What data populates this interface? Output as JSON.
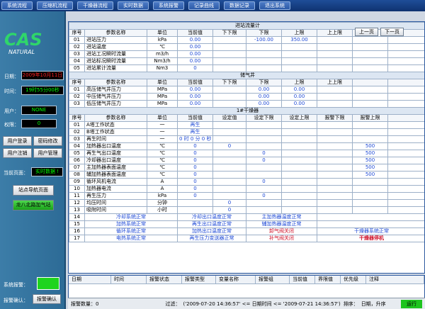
{
  "menu": [
    "系统流程",
    "压缩机流程",
    "干燥器流程",
    "实时数据",
    "系统报警",
    "记录曲线",
    "数据记录",
    "退出系统"
  ],
  "logo": {
    "letters": "CAS",
    "sub": "NATURAL"
  },
  "left": {
    "date_label": "日期：",
    "date_value": "2009年10月11日",
    "time_label": "时间：",
    "time_value": "19时55分00秒",
    "user_label": "用户：",
    "user_value": "NONE",
    "perm_label": "权限：",
    "perm_value": "0",
    "btn_login": "用户登录",
    "btn_pwd": "密码修改",
    "btn_logout": "用户注销",
    "btn_manage": "用户管理",
    "page_label": "当前页面：",
    "page_value": "实时数据 !",
    "btn_nav": "站点导航页面",
    "btn_station": "龙八北路加气站",
    "sys_alarm_label": "系统报警：",
    "alarm_confirm_label": "报警确认：",
    "alarm_confirm_btn": "报警确认"
  },
  "pager": {
    "prev": "上一页",
    "next": "下一页"
  },
  "sec1": {
    "title": "进站流量计",
    "headers": [
      "序号",
      "参数名称",
      "单位",
      "当前值",
      "下下限",
      "下限",
      "上限",
      "上上限"
    ],
    "rows": [
      [
        "01",
        "进站压力",
        "kPa",
        "0.00",
        "",
        "-100.00",
        "350.00",
        ""
      ],
      [
        "02",
        "进站温度",
        "℃",
        "0.00",
        "",
        "",
        "",
        ""
      ],
      [
        "03",
        "进站工况瞬时流量",
        "m3/h",
        "0.00",
        "",
        "",
        "",
        ""
      ],
      [
        "04",
        "进站标况瞬时流量",
        "Nm3/h",
        "0.00",
        "",
        "",
        "",
        ""
      ],
      [
        "05",
        "进站累计流量",
        "Nm3",
        "0",
        "",
        "",
        "",
        ""
      ]
    ]
  },
  "sec2": {
    "title": "储气井",
    "headers": [
      "序号",
      "参数名称",
      "单位",
      "当前值",
      "下下限",
      "下限",
      "上限",
      "上上限"
    ],
    "rows": [
      [
        "01",
        "高压储气井压力",
        "MPa",
        "0.00",
        "",
        "0.00",
        "0.00",
        ""
      ],
      [
        "02",
        "中压储气井压力",
        "MPa",
        "0.00",
        "",
        "0.00",
        "0.00",
        ""
      ],
      [
        "03",
        "低压储气井压力",
        "MPa",
        "0.00",
        "",
        "0.00",
        "0.00",
        ""
      ]
    ]
  },
  "sec3": {
    "title": "1#干燥器",
    "headers": [
      "序号",
      "参数名称",
      "单位",
      "当前值",
      "设定值",
      "设定下限",
      "设定上限",
      "报警下限",
      "报警上限"
    ],
    "rows": [
      [
        "01",
        "A塔工作状态",
        "一",
        "再生",
        "",
        "",
        "",
        "",
        ""
      ],
      [
        "02",
        "B塔工作状态",
        "一",
        "再生",
        "",
        "",
        "",
        "",
        ""
      ],
      [
        "03",
        "再生时间",
        "一",
        "0 时 0 分 0 秒",
        "",
        "",
        "",
        "",
        ""
      ],
      [
        "04",
        "加热器出口温度",
        "℃",
        "0",
        "0",
        "",
        "",
        "",
        "500"
      ],
      [
        "05",
        "再生气出口温度",
        "℃",
        "0",
        "",
        "0",
        "",
        "",
        "500"
      ],
      [
        "06",
        "冷却器出口温度",
        "℃",
        "0",
        "",
        "0",
        "",
        "",
        "500"
      ],
      [
        "07",
        "主加热器表面温度",
        "℃",
        "0",
        "",
        "",
        "",
        "",
        "500"
      ],
      [
        "08",
        "辅加热器表面温度",
        "℃",
        "0",
        "",
        "",
        "",
        "",
        "500"
      ],
      [
        "09",
        "循环风机电流",
        "A",
        "0",
        "",
        "0",
        "",
        "",
        ""
      ],
      [
        "10",
        "加热器电流",
        "A",
        "0",
        "",
        "",
        "",
        "",
        ""
      ],
      [
        "11",
        "再生压力",
        "kPa",
        "0",
        "",
        "0",
        "",
        "",
        ""
      ],
      [
        "12",
        "均压时间",
        "分钟",
        "",
        "0",
        "",
        "",
        "",
        ""
      ],
      [
        "13",
        "吸附时间",
        "小时",
        "",
        "0",
        "",
        "",
        "",
        ""
      ]
    ],
    "status": [
      [
        "14",
        "冷却系统正常",
        "冷却出口温度正常",
        "主加热器温度正常",
        ""
      ],
      [
        "15",
        "加热系统正常",
        "再生出口温度正常",
        "辅加热器温度正常",
        ""
      ],
      [
        "16",
        "循环系统正常",
        "加热出口温度正常",
        "卸气阀关闭",
        "干燥器系统正常"
      ],
      [
        "17",
        "电热系统正常",
        "再生压力变送器正常",
        "补气阀关闭",
        "干燥器停机"
      ]
    ]
  },
  "alarm": {
    "cols": [
      "日期",
      "时间",
      "报警状态",
      "报警类型",
      "变量名称",
      "报警组",
      "当前值",
      "界限值",
      "优先级",
      "注释"
    ]
  },
  "statusbar": {
    "count": "报警数量：0",
    "filter_label": "过滤：",
    "filter": "('2009-07-20 14:36:57' <= 日期时间 <= '2009-07-21 14:36:57')",
    "sort_label": "排序：",
    "sort": "日期，升序",
    "state": "运行"
  },
  "colors": {
    "menu_bg": "#0f3270",
    "left_bg": "#3c7da8",
    "value_blue": "#1d49d6",
    "alarm_red": "#d0152c",
    "led_green": "#00ff00",
    "led_red": "#ff2020"
  }
}
